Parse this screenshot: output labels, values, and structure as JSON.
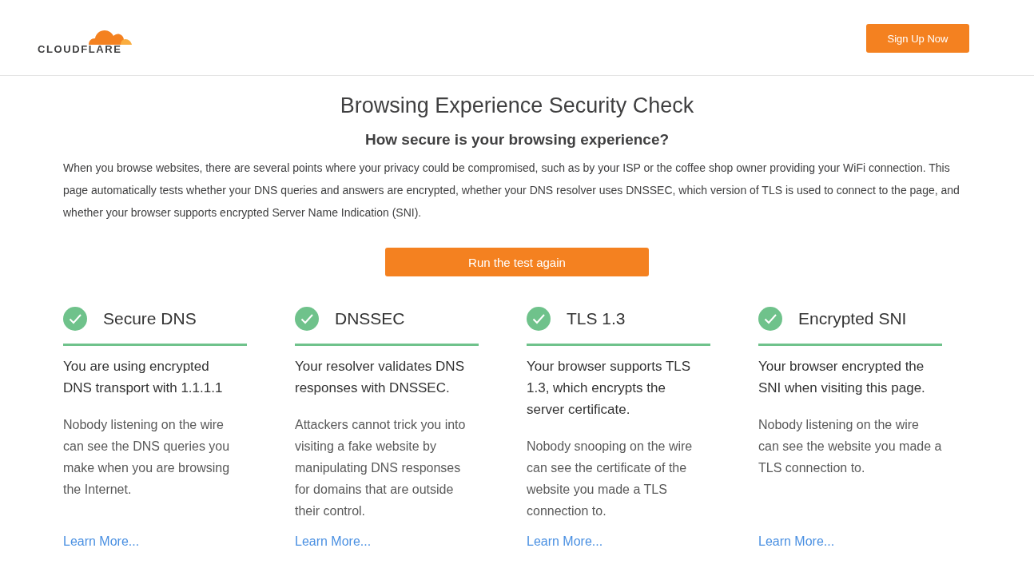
{
  "header": {
    "logo_text": "CLOUDFLARE",
    "signup_button": "Sign Up Now"
  },
  "title": "Browsing Experience Security Check",
  "subtitle": "How secure is your browsing experience?",
  "intro": "When you browse websites, there are several points where your privacy could be compromised, such as by your ISP or the coffee shop owner providing your WiFi connection. This page automatically tests whether your DNS queries and answers are encrypted, whether your DNS resolver uses DNSSEC, which version of TLS is used to connect to the page, and whether your browser supports encrypted Server Name Indication (SNI).",
  "run_button": "Run the test again",
  "checks": [
    {
      "title": "Secure DNS",
      "passed": true,
      "result": "You are using encrypted DNS transport with 1.1.1.1",
      "detail": "Nobody listening on the wire can see the DNS queries you make when you are browsing the Internet.",
      "link": "Learn More..."
    },
    {
      "title": "DNSSEC",
      "passed": true,
      "result": "Your resolver validates DNS responses with DNSSEC.",
      "detail": "Attackers cannot trick you into visiting a fake website by manipulating DNS responses for domains that are outside their control.",
      "link": "Learn More..."
    },
    {
      "title": "TLS 1.3",
      "passed": true,
      "result": "Your browser supports TLS 1.3, which encrypts the server certificate.",
      "detail": "Nobody snooping on the wire can see the certificate of the website you made a TLS connection to.",
      "link": "Learn More..."
    },
    {
      "title": "Encrypted SNI",
      "passed": true,
      "result": "Your browser encrypted the SNI when visiting this page.",
      "detail": "Nobody listening on the wire can see the website you made a TLS connection to.",
      "link": "Learn More..."
    }
  ]
}
